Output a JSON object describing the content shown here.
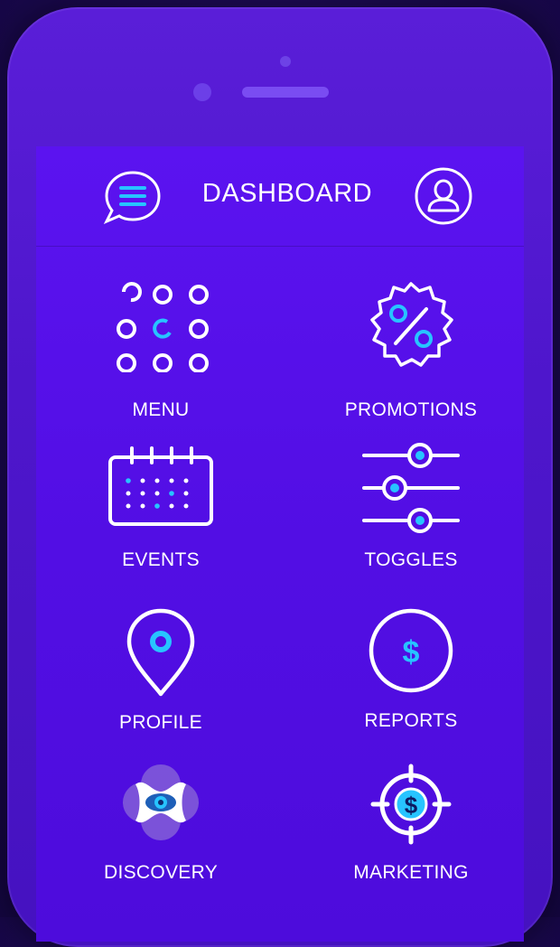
{
  "header": {
    "title": "DASHBOARD",
    "left_icon": "chat-menu-icon",
    "right_icon": "user-icon"
  },
  "tiles": [
    {
      "label": "MENU",
      "icon": "grid-dots-icon"
    },
    {
      "label": "PROMOTIONS",
      "icon": "percent-badge-icon"
    },
    {
      "label": "EVENTS",
      "icon": "calendar-icon"
    },
    {
      "label": "TOGGLES",
      "icon": "sliders-icon"
    },
    {
      "label": "PROFILE",
      "icon": "location-pin-icon"
    },
    {
      "label": "REPORTS",
      "icon": "dollar-circle-icon"
    },
    {
      "label": "DISCOVERY",
      "icon": "eye-flower-icon"
    },
    {
      "label": "MARKETING",
      "icon": "target-dollar-icon"
    }
  ],
  "colors": {
    "background": "#1d0a55",
    "phone": "#5a1ed8",
    "screen": "#5b13f0",
    "accent": "#27c4ff",
    "text": "#ffffff"
  }
}
